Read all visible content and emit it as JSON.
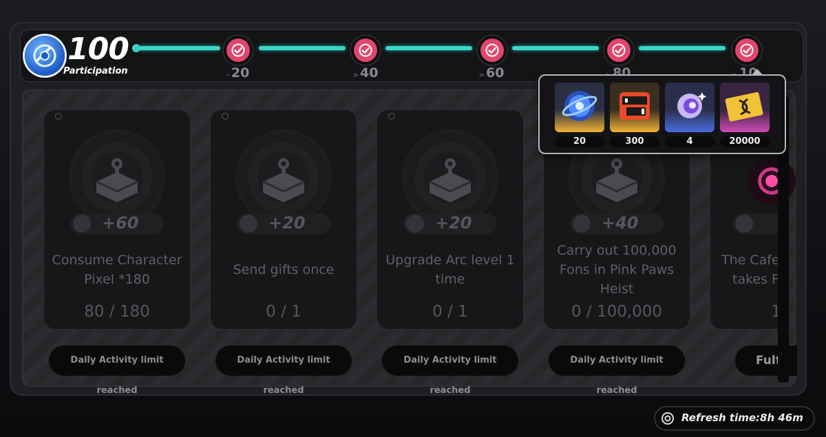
{
  "header": {
    "score": "100",
    "score_label": "Participation",
    "icon": "activity-coin-icon"
  },
  "milestones": [
    {
      "value": "20",
      "claimed": true
    },
    {
      "value": "40",
      "claimed": true
    },
    {
      "value": "60",
      "claimed": true
    },
    {
      "value": "80",
      "claimed": true
    },
    {
      "value": "10",
      "claimed": true
    }
  ],
  "reward_popup": {
    "items": [
      {
        "icon": "polychrome-crystal-icon",
        "qty": "20",
        "rarity_color": "#f2b233"
      },
      {
        "icon": "hunter-emblem-icon",
        "qty": "300",
        "rarity_color": "#f2b233"
      },
      {
        "icon": "purple-orb-icon",
        "qty": "4",
        "rarity_color": "#4a6de0"
      },
      {
        "icon": "dennies-card-icon",
        "qty": "20000",
        "rarity_color": "#d04bb8"
      }
    ]
  },
  "cards": [
    {
      "points": "+60",
      "desc_lines": [
        "Consume Character",
        "Pixel *180"
      ],
      "progress": "80 / 180",
      "button": "Daily Activity limit reached"
    },
    {
      "points": "+20",
      "desc_lines": [
        "Send gifts once"
      ],
      "progress": "0 / 1",
      "button": "Daily Activity limit reached"
    },
    {
      "points": "+20",
      "desc_lines": [
        "Upgrade Arc level 1",
        "time"
      ],
      "progress": "0 / 1",
      "button": "Daily Activity limit reached"
    },
    {
      "points": "+40",
      "desc_lines": [
        "Carry out 100,000",
        "Fons in Pink Paws",
        "Heist"
      ],
      "progress": "0 / 100,000",
      "button": "Daily Activity limit reached"
    },
    {
      "points": "+",
      "desc_lines": [
        "The Cafe",
        "takes Fo"
      ],
      "progress": "1",
      "button": "Fulf"
    }
  ],
  "footer": {
    "refresh_text": "Refresh time:8h 46m"
  },
  "colors": {
    "track": "#3cd6c5",
    "claimed_node": "#e0466e",
    "background": "#1e1f22"
  }
}
